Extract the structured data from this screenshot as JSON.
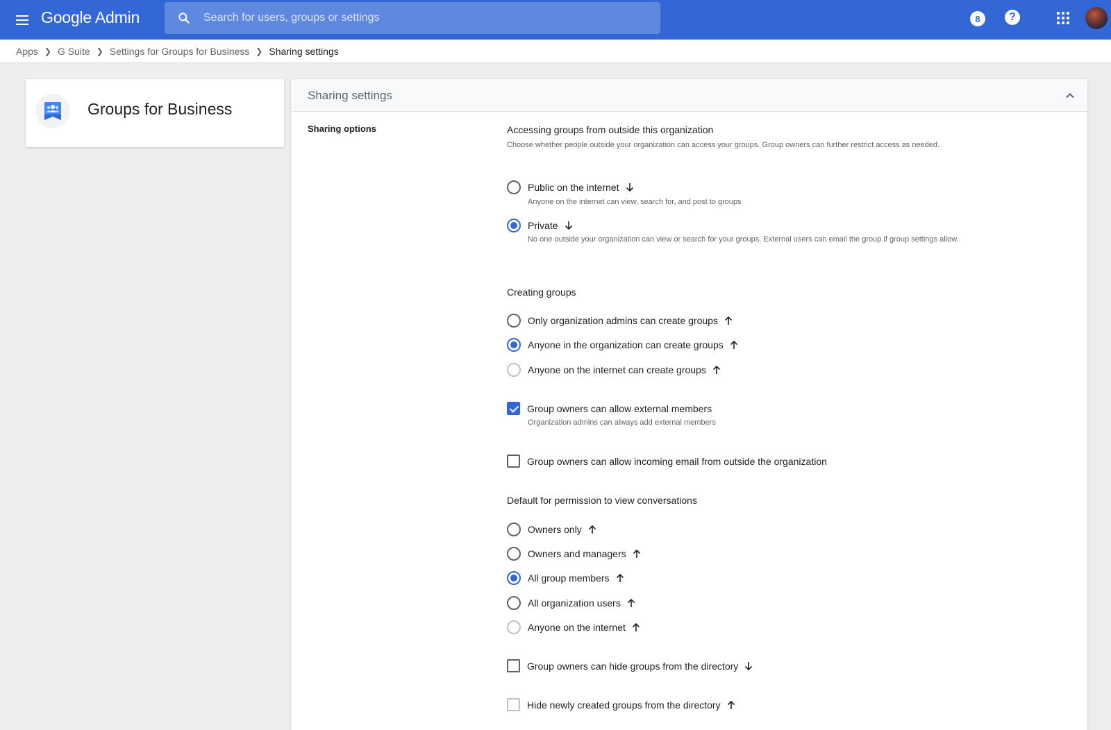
{
  "topbar": {
    "logo": "Google Admin",
    "search_placeholder": "Search for users, groups or settings",
    "badge_text": "8",
    "help_text": "?"
  },
  "breadcrumb": [
    "Apps",
    "G Suite",
    "Settings for Groups for Business",
    "Sharing settings"
  ],
  "app_card": {
    "title": "Groups for Business"
  },
  "panel": {
    "title": "Sharing settings",
    "section_label": "Sharing options",
    "accessing": {
      "title": "Accessing groups from outside this organization",
      "description": "Choose whether people outside your organization can access your groups. Group owners can further restrict access as needed.",
      "options": [
        {
          "label": "Public on the internet",
          "desc": "Anyone on the internet can view, search for, and post to groups",
          "checked": false,
          "arrow": "down"
        },
        {
          "label": "Private",
          "desc": "No one outside your organization can view or search for your groups. External users can email the group if group settings allow.",
          "checked": true,
          "arrow": "down"
        }
      ]
    },
    "creating": {
      "title": "Creating groups",
      "options": [
        {
          "label": "Only organization admins can create groups",
          "checked": false,
          "disabled": false,
          "arrow": "up"
        },
        {
          "label": "Anyone in the organization can create groups",
          "checked": true,
          "disabled": false,
          "arrow": "up"
        },
        {
          "label": "Anyone on the internet can create groups",
          "checked": false,
          "disabled": true,
          "arrow": "up"
        }
      ]
    },
    "external_members": {
      "label": "Group owners can allow external members",
      "desc": "Organization admins can always add external members",
      "checked": true
    },
    "incoming_email": {
      "label": "Group owners can allow incoming email from outside the organization",
      "checked": false
    },
    "view_permission": {
      "title": "Default for permission to view conversations",
      "options": [
        {
          "label": "Owners only",
          "checked": false,
          "disabled": false,
          "arrow": "up"
        },
        {
          "label": "Owners and managers",
          "checked": false,
          "disabled": false,
          "arrow": "up"
        },
        {
          "label": "All group members",
          "checked": true,
          "disabled": false,
          "arrow": "up"
        },
        {
          "label": "All organization users",
          "checked": false,
          "disabled": false,
          "arrow": "up"
        },
        {
          "label": "Anyone on the internet",
          "checked": false,
          "disabled": true,
          "arrow": "up"
        }
      ]
    },
    "hide_groups": {
      "label": "Group owners can hide groups from the directory",
      "checked": false,
      "arrow": "down"
    },
    "hide_new_groups": {
      "label": "Hide newly created groups from the directory",
      "checked": false,
      "disabled": true,
      "arrow": "up"
    }
  },
  "colors": {
    "brand": "#3367d6",
    "background": "#eeeeee"
  }
}
